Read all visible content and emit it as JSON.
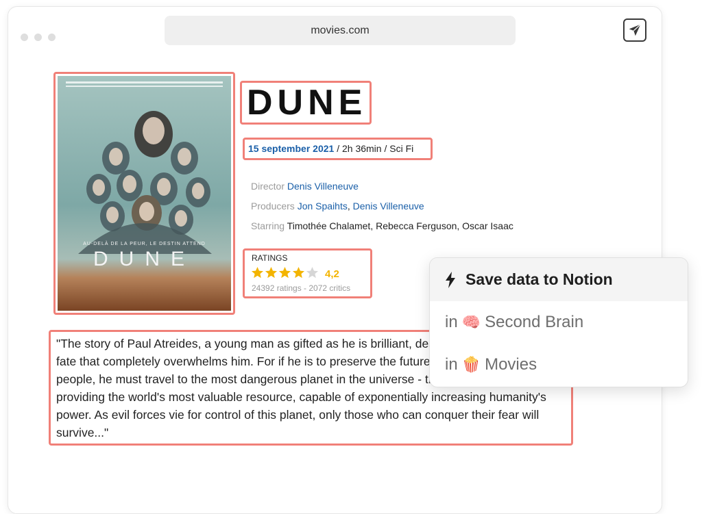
{
  "browser": {
    "url": "movies.com",
    "send_icon": "paper-plane-icon"
  },
  "movie": {
    "title": "DUNE",
    "release_date": "15 september 2021",
    "runtime": " / 2h 36min / ",
    "genre": "Sci Fi",
    "director_label": "Director",
    "director": "Denis Villeneuve",
    "producers_label": "Producers",
    "producer_1": "Jon Spaihts",
    "producer_sep": ", ",
    "producer_2": "Denis Villeneuve",
    "starring_label": "Starring",
    "starring": "Timothée Chalamet, Rebecca Ferguson, Oscar Isaac"
  },
  "poster": {
    "tagline": "AU-DELÀ DE LA PEUR, LE DESTIN ATTEND",
    "logo": "DUNE"
  },
  "ratings": {
    "label": "RATINGS",
    "score": "4,2",
    "stars_filled": 4.2,
    "stars_total": 5,
    "summary": "24392 ratings -  2072 critics",
    "star_color": "#f3b400"
  },
  "synopsis": "\"The story of Paul Atreides, a young man as gifted as he is brilliant, destined to an extraordinary fate that completely overwhelms him. For if he is to preserve the future of his family and his people, he must travel to the most dangerous planet in the universe - the only one capable of providing the world's most valuable resource, capable of exponentially increasing humanity's power. As evil forces vie for control of this planet, only those who can conquer their fear will survive...\"",
  "popup": {
    "title": "Save data to Notion",
    "title_icon": "lightning-icon",
    "items": [
      {
        "prefix": "in",
        "emoji": "🧠",
        "label": "Second Brain"
      },
      {
        "prefix": "in",
        "emoji": "🍿",
        "label": "Movies"
      }
    ]
  },
  "colors": {
    "highlight": "#f08078",
    "link": "#1a5fa8",
    "accent_star": "#f3b400"
  }
}
